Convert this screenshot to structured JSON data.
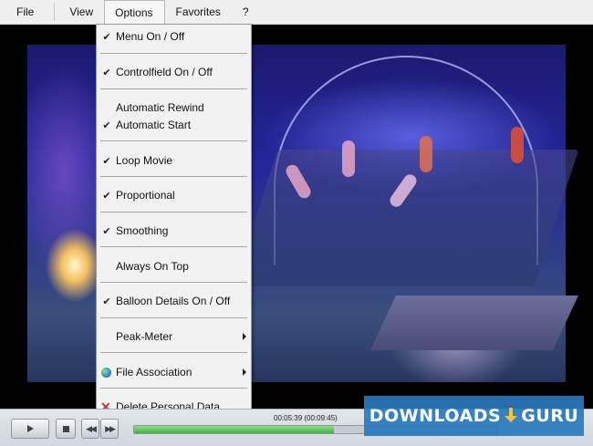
{
  "menubar": {
    "items": [
      "File",
      "View",
      "Options",
      "Favorites",
      "?"
    ]
  },
  "options_menu": {
    "items": [
      {
        "label": "Menu On / Off",
        "checked": true
      },
      {
        "label": "Controlfield On / Off",
        "checked": true
      },
      {
        "label": "Automatic Rewind",
        "checked": false
      },
      {
        "label": "Automatic Start",
        "checked": true
      },
      {
        "label": "Loop Movie",
        "checked": true
      },
      {
        "label": "Proportional",
        "checked": true
      },
      {
        "label": "Smoothing",
        "checked": true
      },
      {
        "label": "Always On Top",
        "checked": false
      },
      {
        "label": "Balloon Details On / Off",
        "checked": true
      },
      {
        "label": "Peak-Meter",
        "checked": false,
        "submenu": true
      },
      {
        "label": "File Association",
        "checked": false,
        "submenu": true,
        "icon": "globe-icon"
      },
      {
        "label": "Delete Personal Data",
        "checked": false,
        "icon": "red-x-icon"
      }
    ]
  },
  "controls": {
    "time": "00:05:39 (00:09:45)",
    "progress": 0.55,
    "buttons": [
      "play-icon",
      "stop-icon",
      "rewind-icon",
      "fast-forward-icon"
    ]
  },
  "watermark": {
    "left": "DOWNLOADS",
    "right": "GURU"
  },
  "colors": {
    "menu_bg": "#f0f0f0",
    "dropdown_bg": "#f2f2f2",
    "progress_fill": "#3cb43c",
    "watermark_bg": "#2878be"
  }
}
